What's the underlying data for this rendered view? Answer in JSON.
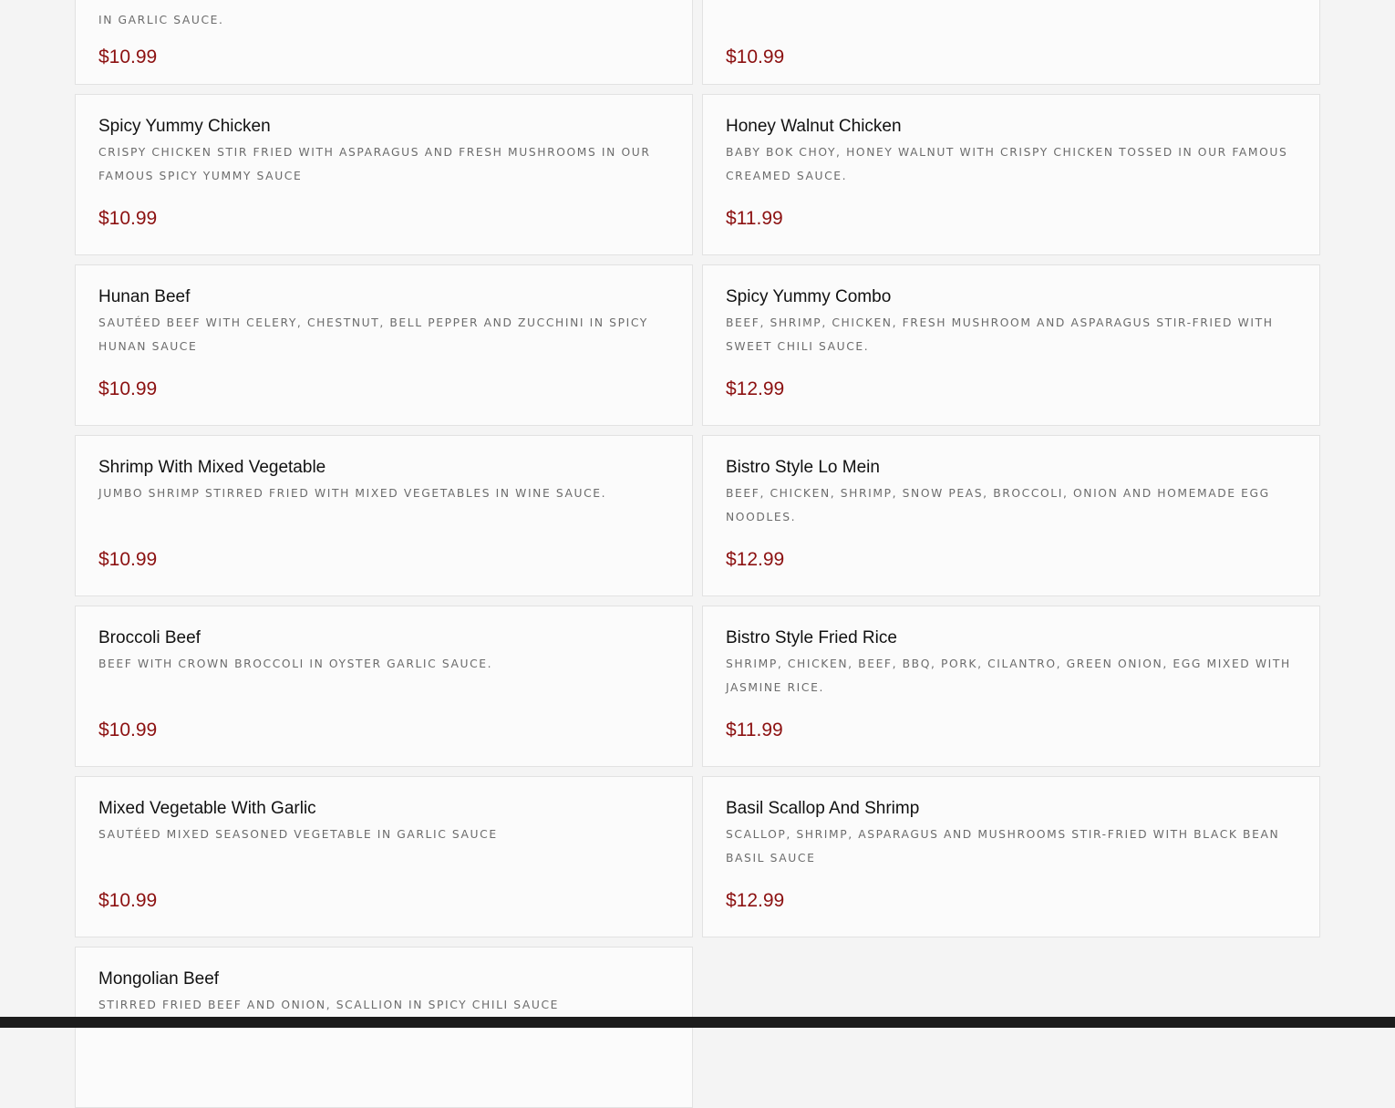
{
  "menu": {
    "items": [
      {
        "name": "",
        "desc": "in garlic sauce.",
        "price": "$10.99"
      },
      {
        "name": "",
        "desc": "",
        "price": "$10.99"
      },
      {
        "name": "Spicy Yummy Chicken",
        "desc": "Crispy chicken stir fried with asparagus and fresh mushrooms in our famous spicy yummy sauce",
        "price": "$10.99"
      },
      {
        "name": "Honey Walnut Chicken",
        "desc": "Baby bok choy, honey walnut with crispy chicken tossed in our famous creamed sauce.",
        "price": "$11.99"
      },
      {
        "name": "Hunan Beef",
        "desc": "Sautéed beef with celery, chestnut, bell pepper and zucchini in spicy Hunan sauce",
        "price": "$10.99"
      },
      {
        "name": "Spicy Yummy Combo",
        "desc": "Beef, shrimp, chicken, fresh mushroom and asparagus stir-fried with sweet chili sauce.",
        "price": "$12.99"
      },
      {
        "name": "Shrimp With Mixed Vegetable",
        "desc": "Jumbo shrimp stirred fried with mixed vegetables in wine sauce.",
        "price": "$10.99"
      },
      {
        "name": "Bistro Style Lo Mein",
        "desc": "Beef, chicken, shrimp, snow peas, broccoli, onion and homemade egg noodles.",
        "price": "$12.99"
      },
      {
        "name": "Broccoli Beef",
        "desc": "Beef with crown broccoli in oyster garlic sauce.",
        "price": "$10.99"
      },
      {
        "name": "Bistro Style Fried Rice",
        "desc": "Shrimp, chicken, beef, BBQ, pork, cilantro, green onion, egg mixed with jasmine rice.",
        "price": "$11.99"
      },
      {
        "name": "Mixed Vegetable With Garlic",
        "desc": "Sautéed mixed seasoned vegetable in garlic sauce",
        "price": "$10.99"
      },
      {
        "name": "Basil Scallop And Shrimp",
        "desc": "Scallop, shrimp, asparagus and mushrooms stir-fried with black bean basil sauce",
        "price": "$12.99"
      },
      {
        "name": "Mongolian Beef",
        "desc": "Stirred fried beef and onion, scallion in spicy chili sauce",
        "price": ""
      }
    ]
  },
  "colors": {
    "background": "#f4f4f4",
    "card_background": "#fbfbfb",
    "card_border": "#e2e2e2",
    "name_text": "#111111",
    "description_text": "#6c6c6c",
    "price_text": "#8c1111",
    "bottom_bar": "#1c1c1c"
  }
}
